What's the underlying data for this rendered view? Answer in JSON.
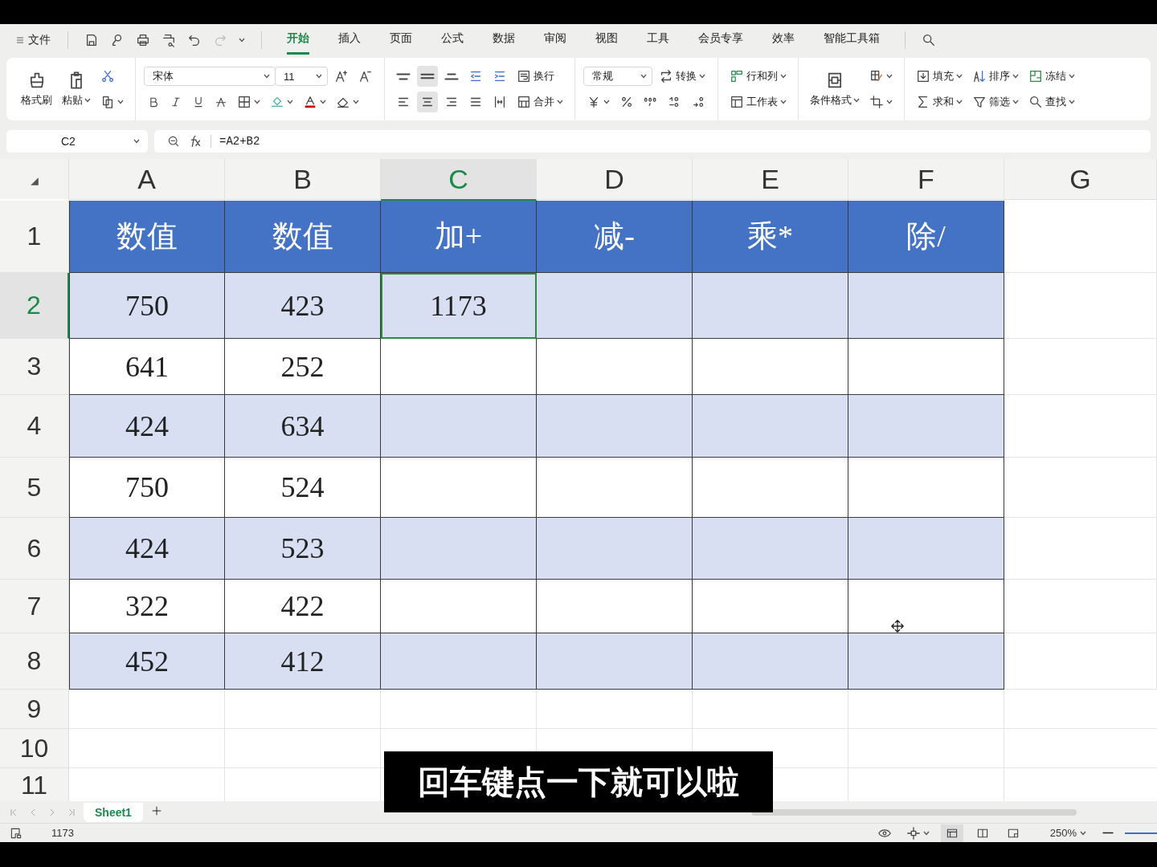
{
  "menu_bar": {
    "file": "文件",
    "tabs": [
      {
        "label": "开始",
        "selected": true
      },
      {
        "label": "插入",
        "selected": false
      },
      {
        "label": "页面",
        "selected": false
      },
      {
        "label": "公式",
        "selected": false
      },
      {
        "label": "数据",
        "selected": false
      },
      {
        "label": "审阅",
        "selected": false
      },
      {
        "label": "视图",
        "selected": false
      },
      {
        "label": "工具",
        "selected": false
      },
      {
        "label": "会员专享",
        "selected": false
      },
      {
        "label": "效率",
        "selected": false
      },
      {
        "label": "智能工具箱",
        "selected": false
      }
    ]
  },
  "ribbon": {
    "clipboard": {
      "format_painter": "格式刷",
      "paste": "粘贴"
    },
    "font": {
      "name": "宋体",
      "size": "11"
    },
    "alignment": {
      "vertical": [
        {
          "selected": false
        },
        {
          "selected": true
        },
        {
          "selected": false
        }
      ],
      "horizontal": [
        {
          "selected": false
        },
        {
          "selected": true
        },
        {
          "selected": false
        },
        {
          "selected": false
        },
        {
          "selected": false
        }
      ],
      "wrap": "换行",
      "merge": "合并"
    },
    "number": {
      "format": "常规",
      "convert": "转换"
    },
    "cells": {
      "rows_columns": "行和列",
      "worksheet": "工作表",
      "conditional_format": "条件格式"
    },
    "editing": {
      "fill": "填充",
      "sum": "求和",
      "sort": "排序",
      "filter": "筛选",
      "freeze": "冻结",
      "find": "查找"
    }
  },
  "formula_bar": {
    "cell_reference": "C2",
    "formula": "=A2+B2"
  },
  "sheet": {
    "columns": [
      {
        "label": "A",
        "selected": false
      },
      {
        "label": "B",
        "selected": false
      },
      {
        "label": "C",
        "selected": true
      },
      {
        "label": "D",
        "selected": false
      },
      {
        "label": "E",
        "selected": false
      },
      {
        "label": "F",
        "selected": false
      },
      {
        "label": "G",
        "selected": false
      }
    ],
    "rows": [
      {
        "label": "1",
        "kind": "header",
        "selected": false,
        "cells": [
          "数值",
          "数值",
          "加+",
          "减-",
          "乘*",
          "除/"
        ]
      },
      {
        "label": "2",
        "kind": "data",
        "shaded": true,
        "selected": true,
        "cells": [
          "750",
          "423",
          "1173"
        ]
      },
      {
        "label": "3",
        "kind": "data",
        "shaded": false,
        "selected": false,
        "cells": [
          "641",
          "252"
        ]
      },
      {
        "label": "4",
        "kind": "data",
        "shaded": true,
        "selected": false,
        "cells": [
          "424",
          "634"
        ]
      },
      {
        "label": "5",
        "kind": "data",
        "shaded": false,
        "selected": false,
        "cells": [
          "750",
          "524"
        ]
      },
      {
        "label": "6",
        "kind": "data",
        "shaded": true,
        "selected": false,
        "cells": [
          "424",
          "523"
        ]
      },
      {
        "label": "7",
        "kind": "data",
        "shaded": false,
        "selected": false,
        "cells": [
          "322",
          "422"
        ]
      },
      {
        "label": "8",
        "kind": "data",
        "shaded": true,
        "selected": false,
        "cells": [
          "452",
          "412"
        ]
      },
      {
        "label": "9",
        "kind": "blank",
        "selected": false
      },
      {
        "label": "10",
        "kind": "blank",
        "selected": false
      },
      {
        "label": "11",
        "kind": "blank",
        "selected": false
      }
    ]
  },
  "sheet_tabs": [
    {
      "label": "Sheet1",
      "selected": true
    }
  ],
  "status_bar": {
    "value": "1173",
    "view_modes": [
      {
        "selected": true
      },
      {
        "selected": false
      },
      {
        "selected": false
      }
    ],
    "zoom": "250%",
    "zoom_slider": {
      "level": 1
    }
  },
  "caption": "回车键点一下就可以啦"
}
